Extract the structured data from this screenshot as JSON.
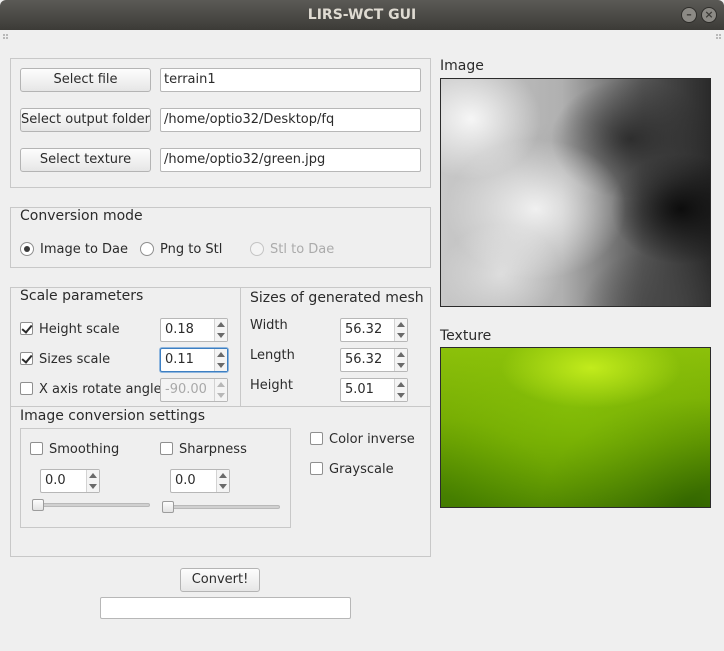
{
  "window": {
    "title": "LIRS-WCT GUI"
  },
  "files": {
    "select_file_label": "Select file",
    "file_value": "terrain1",
    "select_output_label": "Select output folder",
    "output_value": "/home/optio32/Desktop/fq",
    "select_texture_label": "Select texture",
    "texture_value": "/home/optio32/green.jpg"
  },
  "conversion_mode": {
    "title": "Conversion mode",
    "options": [
      {
        "label": "Image to Dae",
        "selected": true,
        "enabled": true
      },
      {
        "label": "Png to Stl",
        "selected": false,
        "enabled": true
      },
      {
        "label": "Stl to Dae",
        "selected": false,
        "enabled": false
      }
    ]
  },
  "scale_parameters": {
    "title": "Scale parameters",
    "height_scale": {
      "label": "Height scale",
      "checked": true,
      "value": "0.18"
    },
    "sizes_scale": {
      "label": "Sizes scale",
      "checked": true,
      "value": "0.11"
    },
    "x_axis_rotate": {
      "label": "X axis rotate angle",
      "checked": false,
      "value": "-90.00"
    }
  },
  "mesh_sizes": {
    "title": "Sizes of generated mesh",
    "width": {
      "label": "Width",
      "value": "56.32"
    },
    "length": {
      "label": "Length",
      "value": "56.32"
    },
    "height": {
      "label": "Height",
      "value": "5.01"
    }
  },
  "image_conversion": {
    "title": "Image conversion settings",
    "smoothing": {
      "label": "Smoothing",
      "checked": false,
      "value": "0.0",
      "slider": 0
    },
    "sharpness": {
      "label": "Sharpness",
      "checked": false,
      "value": "0.0",
      "slider": 0
    },
    "color_inverse": {
      "label": "Color inverse",
      "checked": false
    },
    "grayscale": {
      "label": "Grayscale",
      "checked": false
    }
  },
  "actions": {
    "convert_label": "Convert!"
  },
  "preview": {
    "image_label": "Image",
    "texture_label": "Texture"
  }
}
